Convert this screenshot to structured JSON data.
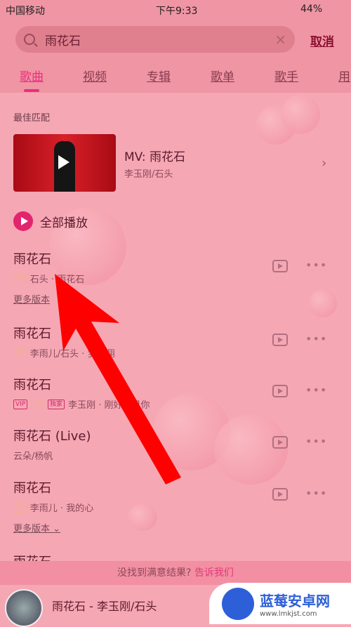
{
  "status": {
    "carrier": "中国移动",
    "time": "下午9:33",
    "battery": "44%"
  },
  "search": {
    "value": "雨花石",
    "cancel": "取消"
  },
  "tabs": [
    "歌曲",
    "视频",
    "专辑",
    "歌单",
    "歌手",
    "用"
  ],
  "best_match": {
    "section": "最佳匹配",
    "title": "MV: 雨花石",
    "artist": "李玉刚/石头"
  },
  "play_all": "全部播放",
  "songs": [
    {
      "title": "雨花石",
      "badges": [
        "SQ"
      ],
      "sub": "石头 · 雨花石",
      "more": "更多版本"
    },
    {
      "title": "雨花石",
      "badges": [
        "SQ"
      ],
      "sub": "李雨儿/石头 · 梦飞翔"
    },
    {
      "title": "雨花石",
      "badges": [
        "VIP",
        "SQ",
        "独家"
      ],
      "sub": "李玉刚 · 刚好遇见你"
    },
    {
      "title": "雨花石 (Live)",
      "badges": [],
      "sub": "云朵/杨帆"
    },
    {
      "title": "雨花石",
      "badges": [
        "SQ"
      ],
      "sub": "李雨儿 · 我的心",
      "more": "更多版本 ⌄"
    },
    {
      "title": "雨花石"
    }
  ],
  "feedback": {
    "text": "没找到满意结果?",
    "link": "告诉我们"
  },
  "player": {
    "now_playing": "雨花石 - 李玉刚/石头"
  },
  "watermark": {
    "name": "蓝莓安卓网",
    "url": "www.lmkjst.com"
  },
  "colors": {
    "accent": "#e8307a",
    "arrow": "#ff0000"
  }
}
